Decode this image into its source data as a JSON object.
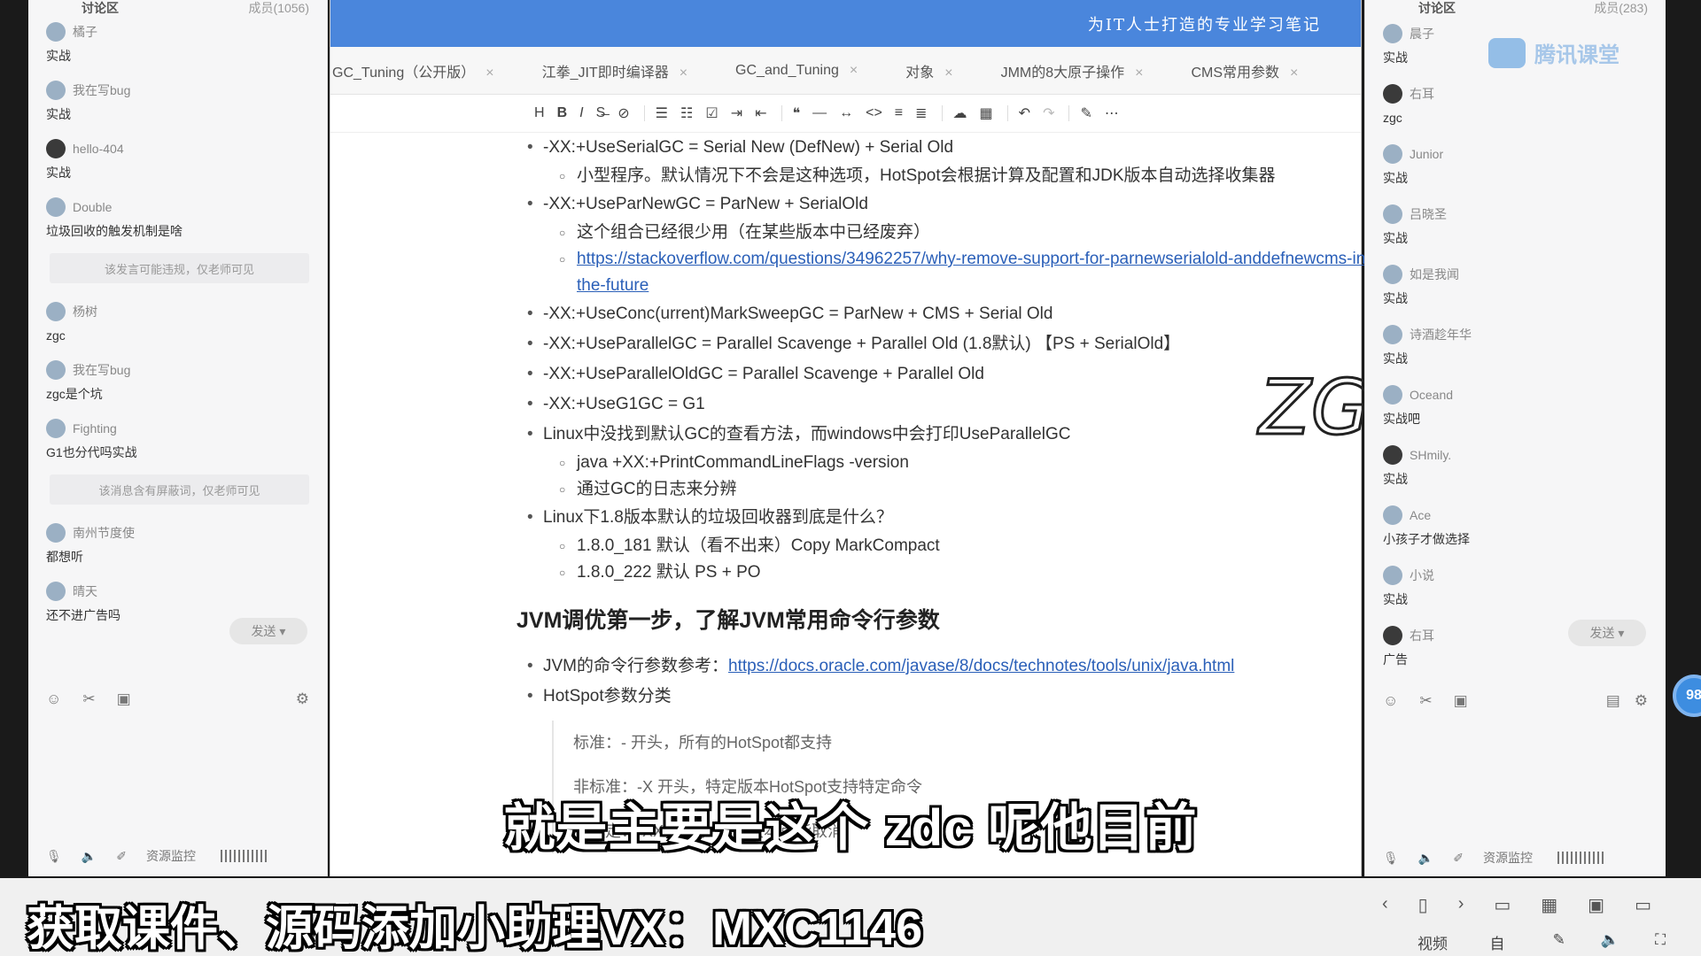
{
  "left_panel": {
    "tab_active": "讨论区",
    "tab_members": "成员(1056)",
    "messages": [
      {
        "user": "橘子",
        "text": "实战"
      },
      {
        "user": "我在写bug",
        "text": "实战"
      },
      {
        "user": "hello-404",
        "text": "实战"
      },
      {
        "user": "Double",
        "text": "垃圾回收的触发机制是啥"
      }
    ],
    "notice1": "该发言可能违规，仅老师可见",
    "messages2": [
      {
        "user": "杨树",
        "text": "zgc"
      },
      {
        "user": "我在写bug",
        "text": "zgc是个坑"
      },
      {
        "user": "Fighting",
        "text": "G1也分代吗实战"
      }
    ],
    "notice2": "该消息含有屏蔽词，仅老师可见",
    "messages3": [
      {
        "user": "南州节度使",
        "text": "都想听"
      },
      {
        "user": "晴天",
        "text": "还不进广告吗"
      }
    ],
    "send_label": "发送",
    "footer_label": "资源监控"
  },
  "banner": "为IT人士打造的专业学习笔记",
  "tabs": [
    {
      "label": "GC_Tuning（公开版）"
    },
    {
      "label": "江拳_JIT即时编译器"
    },
    {
      "label": "GC_and_Tuning"
    },
    {
      "label": "对象"
    },
    {
      "label": "JMM的8大原子操作"
    },
    {
      "label": "CMS常用参数"
    }
  ],
  "toolbar": {
    "items": [
      "H",
      "B",
      "I",
      "S̶",
      "⊘",
      "☰",
      "☷",
      "☑",
      "⇥",
      "⇤",
      "❝",
      "—",
      "↔",
      "<>",
      "≡",
      "≣",
      "☁",
      "▦",
      "↶",
      "↷",
      "✎",
      "⋯"
    ]
  },
  "doc": {
    "l1": "-XX:+UseSerialGC = Serial New (DefNew) + Serial Old",
    "l1a": "小型程序。默认情况下不会是这种选项，HotSpot会根据计算及配置和JDK版本自动选择收集器",
    "l2": "-XX:+UseParNewGC = ParNew + SerialOld",
    "l2a": "这个组合已经很少用（在某些版本中已经废弃）",
    "l2b": "https://stackoverflow.com/questions/34962257/why-remove-support-for-parnewserialold-anddefnewcms-in-the-future",
    "l3": "-XX:+UseConc(urrent)MarkSweepGC = ParNew + CMS + Serial Old",
    "l4": "-XX:+UseParallelGC = Parallel Scavenge + Parallel Old (1.8默认) 【PS + SerialOld】",
    "l5": "-XX:+UseParallelOldGC = Parallel Scavenge + Parallel Old",
    "l6": "-XX:+UseG1GC = G1",
    "l7": "Linux中没找到默认GC的查看方法，而windows中会打印UseParallelGC",
    "l7a": "java +XX:+PrintCommandLineFlags -version",
    "l7b": "通过GC的日志来分辨",
    "l8": "Linux下1.8版本默认的垃圾回收器到底是什么？",
    "l8a": "1.8.0_181 默认（看不出来）Copy MarkCompact",
    "l8b": "1.8.0_222 默认 PS + PO",
    "heading": "JVM调优第一步，了解JVM常用命令行参数",
    "p1_prefix": "JVM的命令行参数参考：",
    "p1_link": "https://docs.oracle.com/javase/8/docs/technotes/tools/unix/java.html",
    "p2": "HotSpot参数分类",
    "q1": "标准：- 开头，所有的HotSpot都支持",
    "q2": "非标准：-X 开头，特定版本HotSpot支持特定命令",
    "q3": "不稳定：-XX 开头，下个版本可能取消",
    "scribble": "ZGC"
  },
  "right_panel": {
    "tab_active": "讨论区",
    "tab_members": "成员(283)",
    "logo_text": "腾讯课堂",
    "messages": [
      {
        "user": "晨子",
        "text": "实战"
      },
      {
        "user": "右耳",
        "text": "zgc"
      },
      {
        "user": "Junior",
        "text": "实战"
      },
      {
        "user": "吕晓圣",
        "text": "实战"
      },
      {
        "user": "如是我闻",
        "text": "实战"
      },
      {
        "user": "诗酒趁年华",
        "text": "实战"
      },
      {
        "user": "Oceand",
        "text": "实战吧"
      },
      {
        "user": "SHmily.",
        "text": "实战"
      },
      {
        "user": "Ace",
        "text": "小孩子才做选择"
      },
      {
        "user": "小说",
        "text": "实战"
      },
      {
        "user": "右耳",
        "text": "广告"
      }
    ],
    "send_label": "发送",
    "footer_label": "资源监控"
  },
  "badge": "98",
  "player": {
    "video_settings": "视频设置",
    "auto_fit": "自适应"
  },
  "subtitle": "就是主要是这个 zdc 呢他目前",
  "promo": "获取课件、源码添加小助理VX：MXC1146"
}
